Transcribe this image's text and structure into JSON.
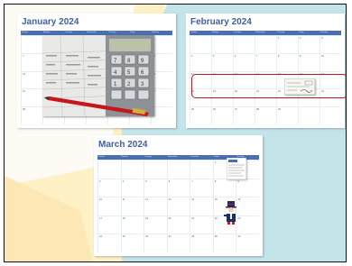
{
  "calendars": {
    "january": {
      "title": "January 2024",
      "weekdays": [
        "Sunday",
        "Monday",
        "Tuesday",
        "Wednesday",
        "Thursday",
        "Friday",
        "Saturday"
      ],
      "days": [
        "",
        "1",
        "2",
        "3",
        "4",
        "5",
        "6",
        "7",
        "8",
        "9",
        "10",
        "11",
        "12",
        "13",
        "14",
        "15",
        "16",
        "17",
        "18",
        "19",
        "20",
        "21",
        "22",
        "23",
        "24",
        "25",
        "26",
        "27",
        "28",
        "29",
        "30",
        "31",
        "",
        "",
        ""
      ]
    },
    "february": {
      "title": "February 2024",
      "weekdays": [
        "Sunday",
        "Monday",
        "Tuesday",
        "Wednesday",
        "Thursday",
        "Friday",
        "Saturday"
      ],
      "days": [
        "",
        "",
        "",
        "",
        "1",
        "2",
        "3",
        "4",
        "5",
        "6",
        "7",
        "8",
        "9",
        "10",
        "11",
        "12",
        "13",
        "14",
        "15",
        "16",
        "17",
        "18",
        "19",
        "20",
        "21",
        "22",
        "23",
        "24",
        "25",
        "26",
        "27",
        "28",
        "29",
        "",
        ""
      ]
    },
    "march": {
      "title": "March 2024",
      "weekdays": [
        "Sunday",
        "Monday",
        "Tuesday",
        "Wednesday",
        "Thursday",
        "Friday",
        "Saturday"
      ],
      "days": [
        "",
        "",
        "",
        "",
        "",
        "1",
        "2",
        "3",
        "4",
        "5",
        "6",
        "7",
        "8",
        "9",
        "10",
        "11",
        "12",
        "13",
        "14",
        "15",
        "16",
        "17",
        "18",
        "19",
        "20",
        "21",
        "22",
        "23",
        "24",
        "25",
        "26",
        "27",
        "28",
        "29",
        "30"
      ]
    }
  },
  "clipart": {
    "january_photo": "finance-calculator-pen-image",
    "february_check": "check-image",
    "march_document": "tax-form-image",
    "march_figure": "uncle-sam-image"
  },
  "colors": {
    "title": "#3f5fa0",
    "header_bar": "#4a6fb0",
    "highlight_border": "#b01c24",
    "background_teal": "#c3e4e8",
    "background_peach": "#fff1c6"
  }
}
